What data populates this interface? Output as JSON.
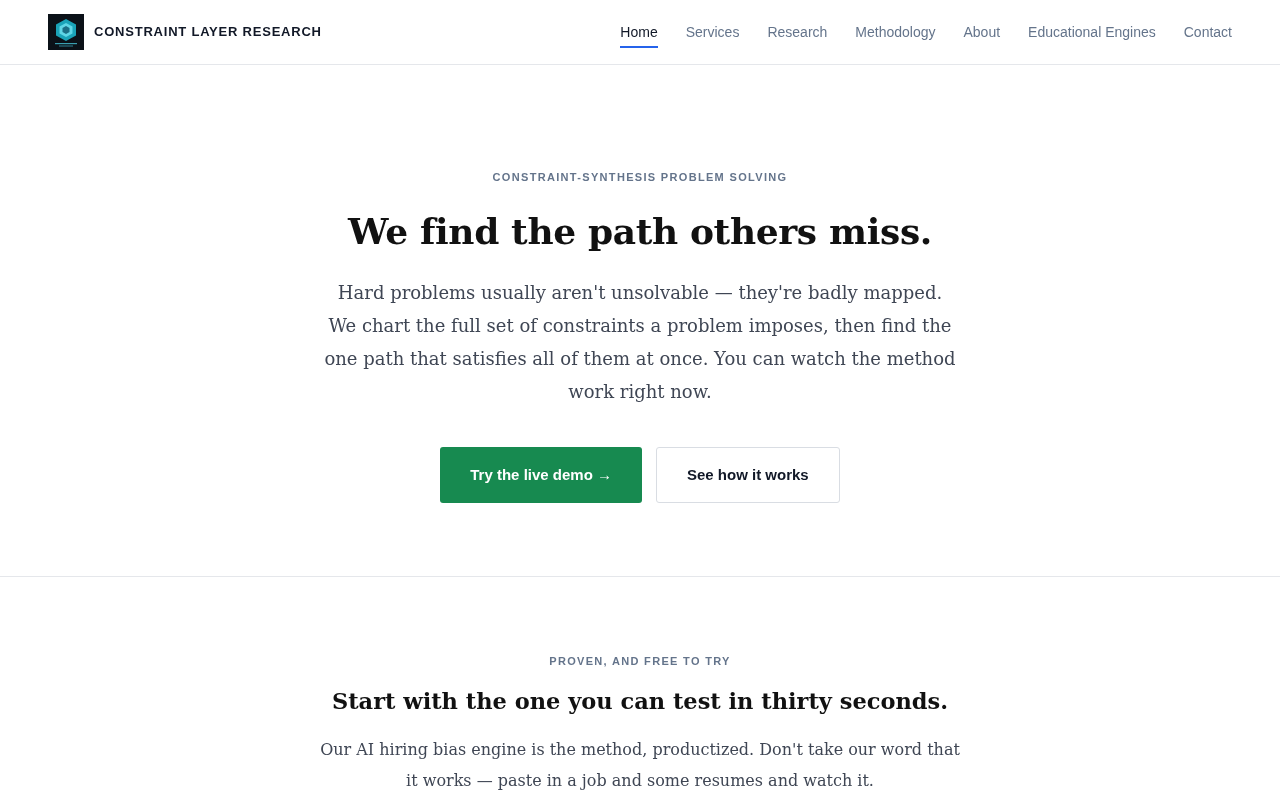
{
  "header": {
    "brand": "CONSTRAINT LAYER RESEARCH",
    "nav": [
      {
        "label": "Home",
        "selected": true
      },
      {
        "label": "Services",
        "selected": false
      },
      {
        "label": "Research",
        "selected": false
      },
      {
        "label": "Methodology",
        "selected": false
      },
      {
        "label": "About",
        "selected": false
      },
      {
        "label": "Educational Engines",
        "selected": false
      },
      {
        "label": "Contact",
        "selected": false
      }
    ]
  },
  "hero": {
    "eyebrow": "CONSTRAINT-SYNTHESIS PROBLEM SOLVING",
    "title": "We find the path others miss.",
    "text": "Hard problems usually aren't unsolvable — they're badly mapped. We chart the full set of constraints a problem imposes, then find the one path that satisfies all of them at once. You can watch the method work right now.",
    "buttons": [
      {
        "label": "Try the live demo →",
        "kind": "primary"
      },
      {
        "label": "See how it works",
        "kind": "secondary"
      }
    ]
  },
  "section": {
    "eyebrow": "PROVEN, AND FREE TO TRY",
    "title": "Start with the one you can test in thirty seconds.",
    "text": "Our AI hiring bias engine is the method, productized. Don't take our word that it works — paste in a job and some resumes and watch it."
  }
}
